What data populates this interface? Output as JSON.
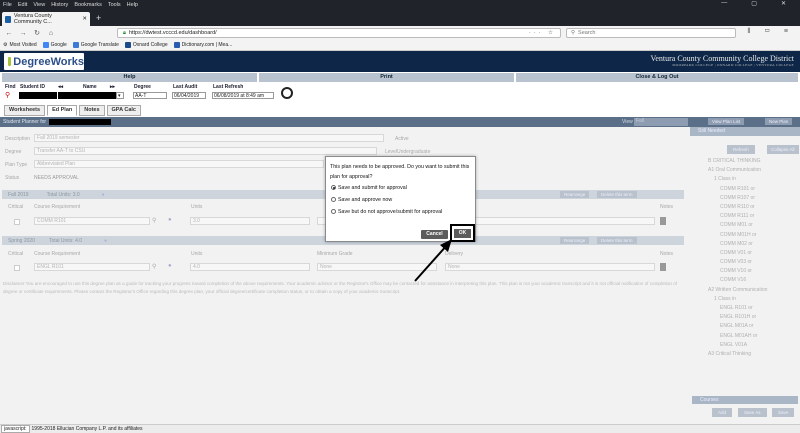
{
  "browser": {
    "menu": [
      "File",
      "Edit",
      "View",
      "History",
      "Bookmarks",
      "Tools",
      "Help"
    ],
    "window_controls": [
      "—",
      "▢",
      "✕"
    ],
    "tab_title": "Ventura County Community C...",
    "url": "https://dwtest.vcccd.edu/dashboard/",
    "search_placeholder": "Search",
    "bookmarks": [
      "Most Visited",
      "Google",
      "Google Translate",
      "Oxnard College",
      "Dictionary.com | Mea..."
    ]
  },
  "header": {
    "logo_text": "DegreeWorks",
    "college_name": "Ventura County Community College District",
    "college_sub": "MOORPARK COLLEGE | OXNARD COLLEGE | VENTURA COLLEGE",
    "menu": [
      "Help",
      "Print",
      "Close & Log Out"
    ]
  },
  "student": {
    "find_label": "Find",
    "id_label": "Student ID",
    "name_label": "Name",
    "degree_label": "Degree",
    "degree_value": "AA-T",
    "last_audit_label": "Last Audit",
    "last_audit_value": "06/04/2019",
    "last_refresh_label": "Last Refresh",
    "last_refresh_value": "06/08/2019 at 8:49 am"
  },
  "subtabs": [
    "Worksheets",
    "Ed Plan",
    "Notes",
    "GPA Calc"
  ],
  "planbar": {
    "label": "Student Planner for",
    "view_label": "View",
    "view_value": "Fall",
    "view_plan_list": "View Plan List",
    "new_plan": "New Plan"
  },
  "plan": {
    "description_label": "Description",
    "description_value": "Fall 2019 semester",
    "active_label": "Active",
    "degree_label": "Degree",
    "degree_value": "Transfer AA-T to CSU",
    "level_label": "Level",
    "level_value": "Undergraduate",
    "plantype_label": "Plan Type",
    "plantype_value": "Abbreviated Plan",
    "status_label": "Status",
    "status_value": "NEEDS APPROVAL"
  },
  "terms": [
    {
      "name": "Fall 2019",
      "units": "Total Units: 3.0",
      "course": "COMM R101",
      "unit": "3.0",
      "grade": "None"
    },
    {
      "name": "Spring 2020",
      "units": "Total Units: 4.0",
      "course": "ENGL R101",
      "unit": "4.0",
      "grade": "None",
      "delivery": "None"
    }
  ],
  "term_buttons": {
    "rearrange": "Rearrange",
    "delete": "Delete this term"
  },
  "columns": {
    "critical": "Critical",
    "course": "Course Requirement",
    "units": "Units",
    "min_grade": "Minimum Grade",
    "delivery": "Delivery",
    "notes": "Notes"
  },
  "disclaimer": "Disclaimer:You are encouraged to use this degree plan as a guide for tracking your progress toward completion of the above requirements. Your academic advisor or the Registrar's Office may be contacted for assistance in interpreting this plan. This plan is not your academic transcript and it is not official notification of completion of degree or certificate requirements. Please contact the Registrar's Office regarding this degree plan, your official degree/certificate completion status, or to obtain a copy of your academic transcript.",
  "rightpanel": {
    "title": "Still Needed",
    "refresh": "Refresh",
    "collapse_all": "Collapse All",
    "items": [
      "B CRITICAL THINKING",
      "A1 Oral Communication",
      "1 Class in",
      "COMM R101 or",
      "COMM R107 or",
      "COMM R110 or",
      "COMM R111 or",
      "COMM M01 or",
      "COMM M01H or",
      "COMM M02 or",
      "COMM V01 or",
      "COMM V03 or",
      "COMM V10 or",
      "COMM V16",
      "A2 Written Communication",
      "1 Class in",
      "ENGL R101 or",
      "ENGL R101H or",
      "ENGL M01A or",
      "ENGL M01AH or",
      "ENGL V01A",
      "A3 Critical Thinking"
    ],
    "courses_label": "Courses",
    "add": "Add",
    "save_as": "Save As",
    "save": "Save"
  },
  "modal": {
    "message": "This plan needs to be approved. Do you want to submit this plan for approval?",
    "options": [
      "Save and submit for approval",
      "Save and approve now",
      "Save but do not approve/submit for approval"
    ],
    "selected": 0,
    "cancel": "Cancel",
    "ok": "OK"
  },
  "status": {
    "prefix": "javascript:",
    "copyright": "1995-2018 Ellucian Company L.P. and its affiliates"
  }
}
